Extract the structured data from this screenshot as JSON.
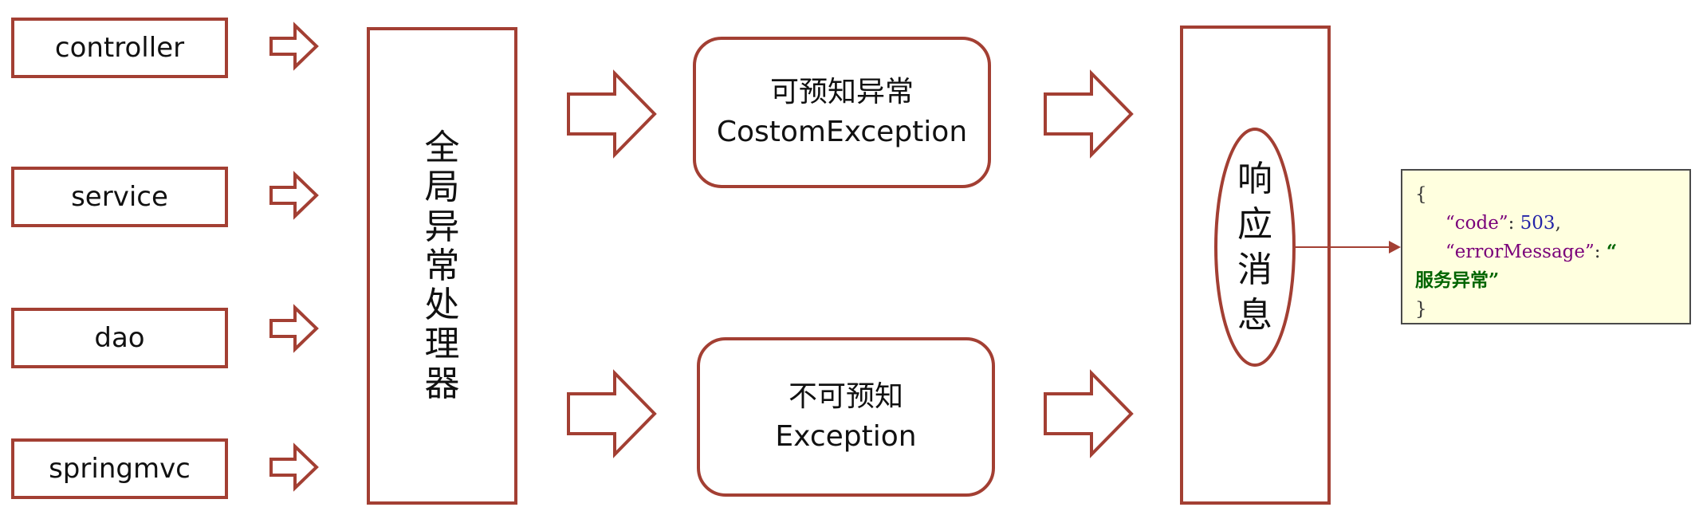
{
  "sources": [
    {
      "label": "controller"
    },
    {
      "label": "service"
    },
    {
      "label": "dao"
    },
    {
      "label": "springmvc"
    }
  ],
  "global_handler": {
    "chars": [
      "全",
      "局",
      "异",
      "常",
      "处",
      "理",
      "器"
    ]
  },
  "predictable": {
    "title": "可预知异常",
    "subtitle": "CostomException"
  },
  "unpredictable": {
    "title": "不可预知",
    "subtitle": "Exception"
  },
  "response": {
    "chars": [
      "响",
      "应",
      "消",
      "息"
    ]
  },
  "json_panel": {
    "open_brace": "{",
    "code_key": "“code”",
    "code_sep": ": ",
    "code_value": "503",
    "code_comma": ",",
    "msg_key": "“errorMessage”",
    "msg_sep": ": ",
    "msg_value_open": "“",
    "msg_value": "服务异常",
    "msg_value_close": "”",
    "close_brace": "}"
  },
  "colors": {
    "box_stroke": "#a33f33",
    "arrow_stroke": "#a33f33",
    "connector": "#a33f33",
    "json_bg": "#ffffdf"
  }
}
